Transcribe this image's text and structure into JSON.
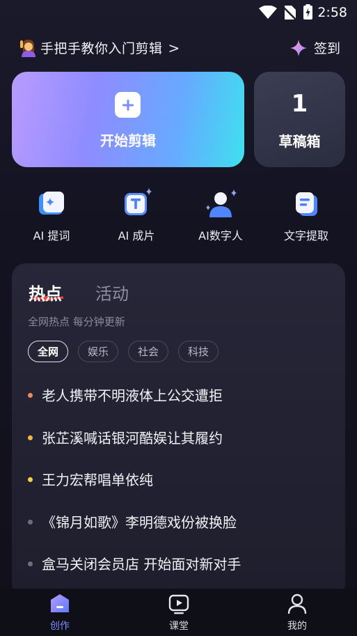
{
  "status_bar": {
    "time": "2:58"
  },
  "header": {
    "tutorial_text": "手把手教你入门剪辑",
    "tutorial_chevron": ">",
    "checkin_label": "签到"
  },
  "main_cards": {
    "start_label": "开始剪辑",
    "drafts_count": "1",
    "drafts_label": "草稿箱"
  },
  "tools": [
    {
      "label": "AI 提词",
      "icon": "ai-prompter-icon"
    },
    {
      "label": "AI 成片",
      "icon": "ai-video-icon"
    },
    {
      "label": "AI数字人",
      "icon": "ai-avatar-icon"
    },
    {
      "label": "文字提取",
      "icon": "text-extract-icon"
    }
  ],
  "hot": {
    "tab_hot": "热点",
    "tab_activity": "活动",
    "subtitle": "全网热点 每分钟更新",
    "chips": [
      "全网",
      "娱乐",
      "社会",
      "科技"
    ],
    "active_chip": "全网",
    "items": [
      {
        "text": "老人携带不明液体上公交遭拒",
        "dot_color": "#f08a5d"
      },
      {
        "text": "张芷溪喊话银河酷娱让其履约",
        "dot_color": "#f5b642"
      },
      {
        "text": "王力宏帮唱单依纯",
        "dot_color": "#f5d142"
      },
      {
        "text": "《锦月如歌》李明德戏份被换脸",
        "dot_color": "#6c6c8a"
      },
      {
        "text": "盒马关闭会员店 开始面对新对手",
        "dot_color": "#6c6c8a"
      }
    ]
  },
  "bottom_nav": {
    "items": [
      {
        "label": "创作",
        "icon": "create-icon",
        "active": true
      },
      {
        "label": "课堂",
        "icon": "classroom-icon",
        "active": false
      },
      {
        "label": "我的",
        "icon": "profile-icon",
        "active": false
      }
    ]
  },
  "colors": {
    "accent": "#7f8bff",
    "start_gradient": [
      "#b89bff",
      "#3fe0ef"
    ]
  }
}
